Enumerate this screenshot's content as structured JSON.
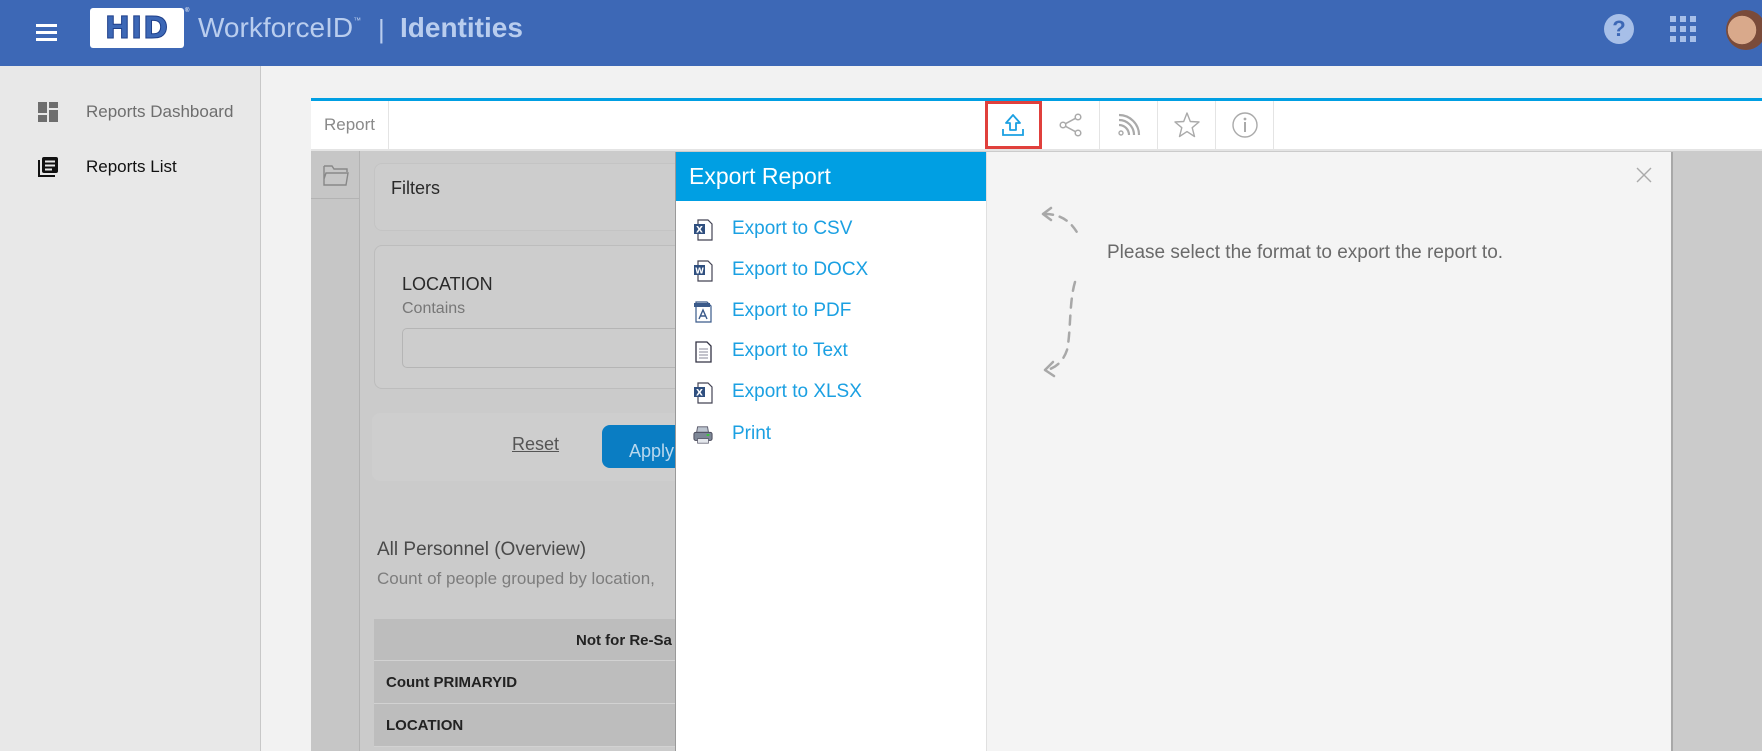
{
  "header": {
    "logo": "HID",
    "brand": "WorkforceID",
    "brand_tm": "™",
    "separator": "|",
    "app_title": "Identities",
    "help_glyph": "?"
  },
  "sidebar": {
    "items": [
      {
        "label": "Reports Dashboard",
        "icon": "dashboard-icon",
        "active": false
      },
      {
        "label": "Reports List",
        "icon": "list-icon",
        "active": true
      }
    ]
  },
  "toolbar": {
    "report_tab": "Report",
    "buttons": [
      {
        "name": "export",
        "icon": "export-icon",
        "active": true
      },
      {
        "name": "share",
        "icon": "share-icon"
      },
      {
        "name": "rss",
        "icon": "rss-icon"
      },
      {
        "name": "favourite",
        "icon": "star-icon"
      },
      {
        "name": "info",
        "icon": "info-icon"
      }
    ]
  },
  "filters": {
    "title": "Filters",
    "field": "LOCATION",
    "operator": "Contains",
    "value": "",
    "reset_label": "Reset",
    "apply_label": "Apply"
  },
  "report": {
    "title": "All Personnel (Overview)",
    "description": "Count of people grouped by location,",
    "table": {
      "header": "Not for Re-Sa",
      "rows": [
        "Count PRIMARYID",
        "LOCATION"
      ]
    }
  },
  "export_modal": {
    "title": "Export Report",
    "options": [
      {
        "label": "Export to CSV",
        "icon": "csv-file-icon"
      },
      {
        "label": "Export to DOCX",
        "icon": "docx-file-icon"
      },
      {
        "label": "Export to PDF",
        "icon": "pdf-file-icon"
      },
      {
        "label": "Export to Text",
        "icon": "text-file-icon"
      },
      {
        "label": "Export to XLSX",
        "icon": "xlsx-file-icon"
      },
      {
        "label": "Print",
        "icon": "printer-icon"
      }
    ],
    "instruction": "Please select the format to export the report to.",
    "close_glyph": "×"
  },
  "colors": {
    "header_bg": "#3d68b6",
    "accent_blue": "#009fe3",
    "link_blue": "#1ba0e2",
    "active_outline": "#e0403c"
  }
}
